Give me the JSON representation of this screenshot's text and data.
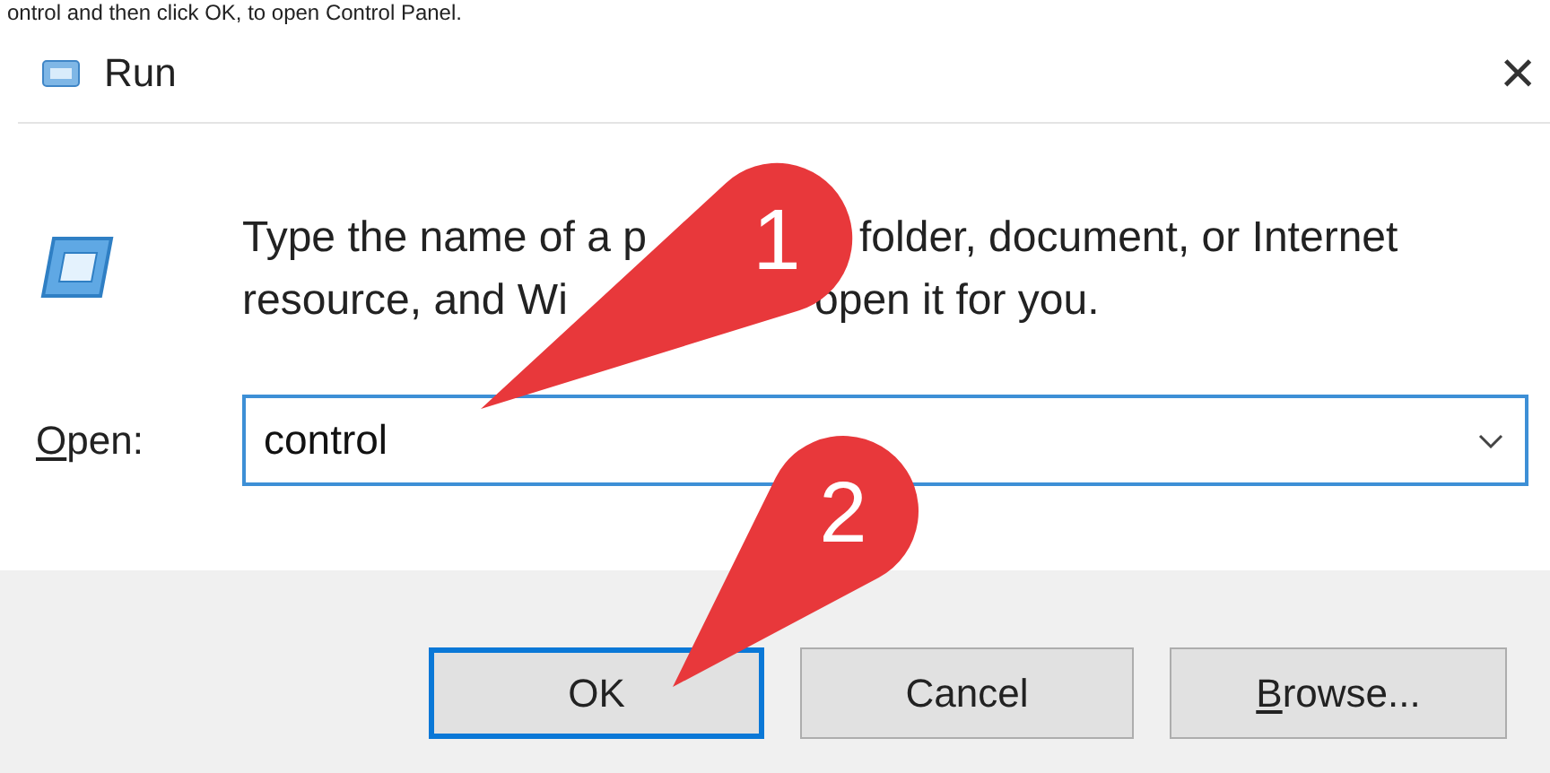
{
  "caption": "ontrol and then click OK, to open Control Panel.",
  "window": {
    "title": "Run",
    "close": "×"
  },
  "prompt": {
    "line_1": [
      "Type the name of a p",
      "folder, document, or Internet"
    ],
    "line_2": [
      "resource, and Wi",
      "open it for you."
    ]
  },
  "open_field": {
    "label": "Open:",
    "access_key_underlined": true,
    "value": "control"
  },
  "buttons": [
    {
      "label": "OK",
      "default": true,
      "access_key_underlined": false
    },
    {
      "label": "Cancel",
      "default": false,
      "access_key_underlined": false
    },
    {
      "label": "Browse...",
      "default": false,
      "access_key_underlined": true
    }
  ],
  "callouts": [
    {
      "number": "1"
    },
    {
      "number": "2"
    }
  ]
}
